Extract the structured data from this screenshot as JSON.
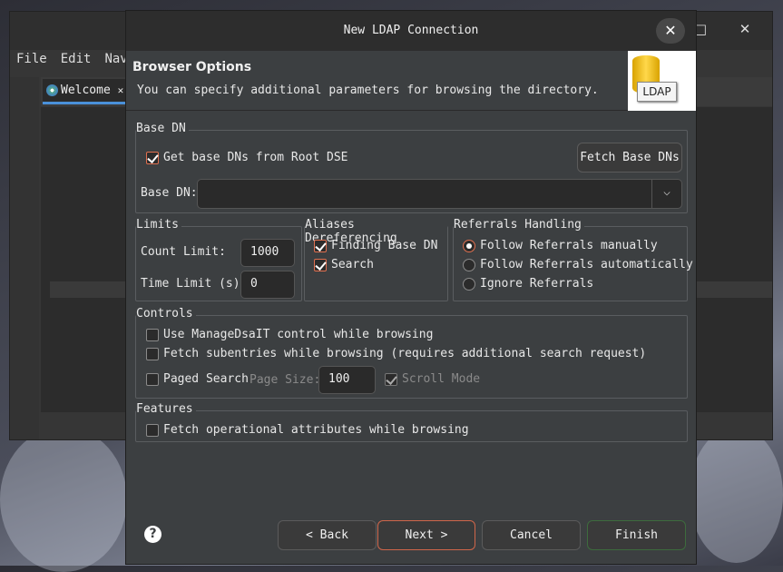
{
  "background_window": {
    "controls": [
      "□",
      "✕"
    ],
    "menu": [
      "File",
      "Edit",
      "Navig"
    ],
    "tab_label": "Welcome",
    "tab_close": "✕"
  },
  "dialog": {
    "title": "New LDAP Connection",
    "close": "✕",
    "header_title": "Browser Options",
    "header_desc": "You can specify additional parameters for browsing the directory.",
    "logo_text": "LDAP"
  },
  "base_dn": {
    "group_label": "Base DN",
    "get_from_root_dse": "Get base DNs from Root DSE",
    "get_from_root_dse_checked": true,
    "fetch_button": "Fetch Base DNs",
    "field_label": "Base DN:",
    "value": "",
    "dropdown_glyph": "⌵"
  },
  "limits": {
    "group_label": "Limits",
    "count_label": "Count Limit:",
    "count_value": "1000",
    "time_label": "Time Limit (s):",
    "time_value": "0"
  },
  "aliases": {
    "group_label": "Aliases Dereferencing",
    "finding_base_dn": "Finding Base DN",
    "finding_checked": true,
    "search": "Search",
    "search_checked": true
  },
  "referrals": {
    "group_label": "Referrals Handling",
    "options": [
      "Follow Referrals manually",
      "Follow Referrals automatically",
      "Ignore Referrals"
    ],
    "selected_index": 0
  },
  "controls": {
    "group_label": "Controls",
    "manage_dsait": "Use ManageDsaIT control while browsing",
    "fetch_subentries": "Fetch subentries while browsing (requires additional search request)",
    "paged_search": "Paged Search",
    "page_size_label": "Page Size:",
    "page_size_value": "100",
    "scroll_mode": "Scroll Mode",
    "scroll_mode_checked": true
  },
  "features": {
    "group_label": "Features",
    "fetch_operational": "Fetch operational attributes while browsing"
  },
  "buttons": {
    "help": "?",
    "back": "< Back",
    "next": "Next >",
    "cancel": "Cancel",
    "finish": "Finish"
  },
  "colors": {
    "accent": "#e07050",
    "dialog_bg": "#3c3f41",
    "finish_border": "#3d6b3d"
  }
}
